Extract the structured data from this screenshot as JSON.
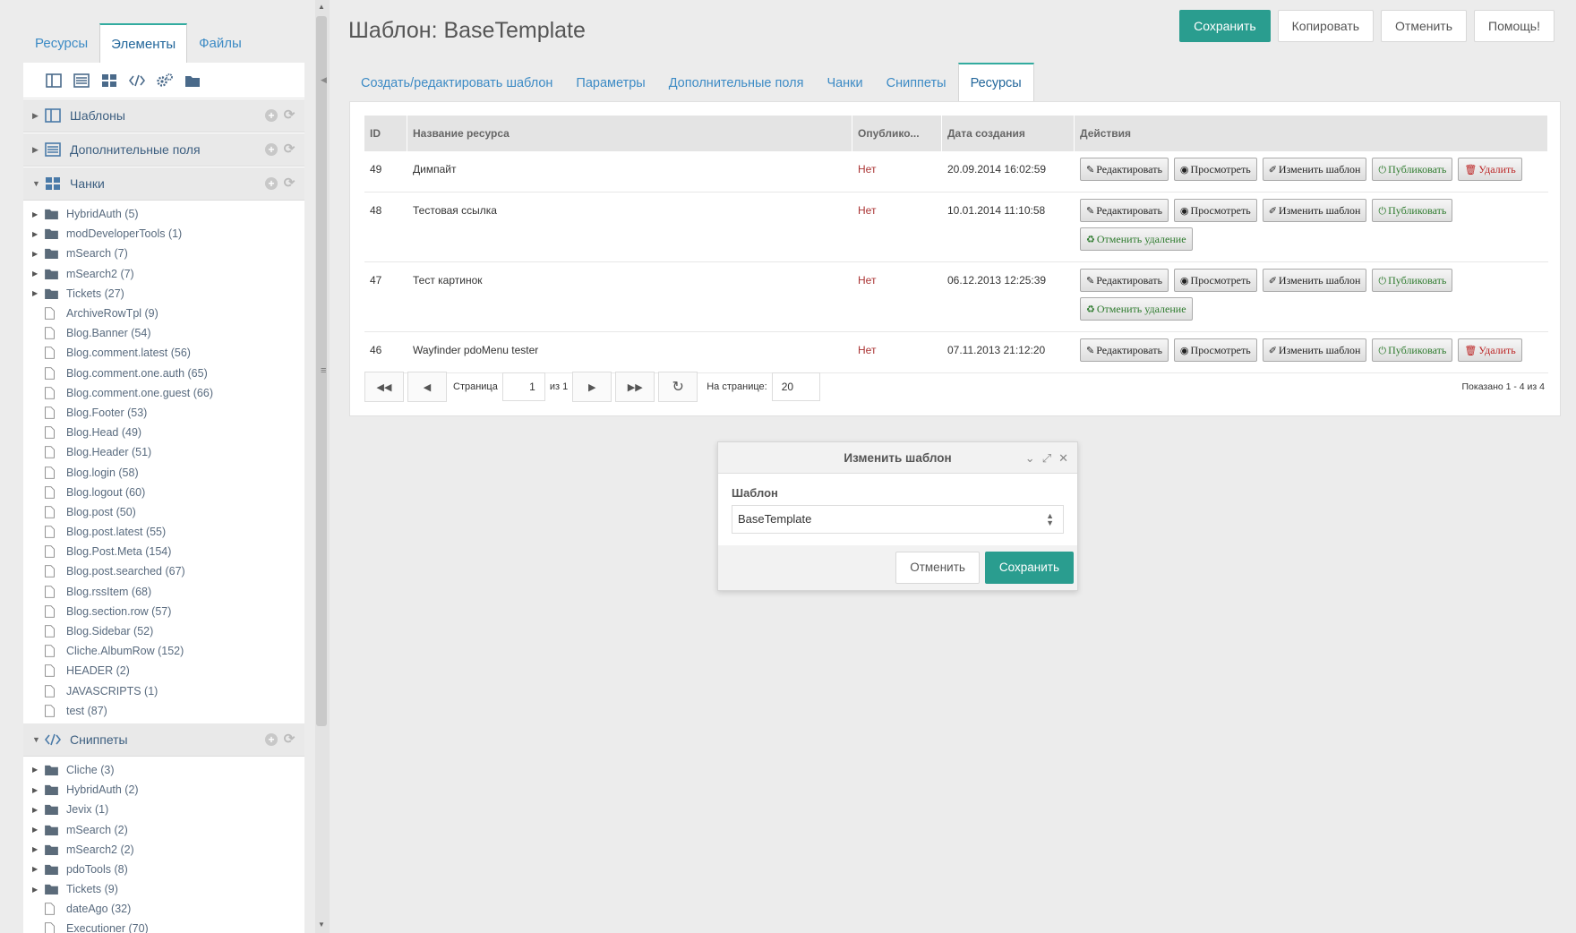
{
  "left": {
    "tabs": [
      {
        "label": "Ресурсы"
      },
      {
        "label": "Элементы"
      },
      {
        "label": "Файлы"
      }
    ],
    "toolbar_icons": [
      "template-icon",
      "tv-icon",
      "chunk-icon",
      "code-icon",
      "gears-icon",
      "folder-icon"
    ],
    "sections": {
      "templates": {
        "title": "Шаблоны"
      },
      "tvs": {
        "title": "Дополнительные поля"
      },
      "chunks": {
        "title": "Чанки",
        "items": [
          {
            "label": "HybridAuth (5)",
            "type": "folder"
          },
          {
            "label": "modDeveloperTools (1)",
            "type": "folder"
          },
          {
            "label": "mSearch (7)",
            "type": "folder"
          },
          {
            "label": "mSearch2 (7)",
            "type": "folder"
          },
          {
            "label": "Tickets (27)",
            "type": "folder"
          },
          {
            "label": "ArchiveRowTpl (9)",
            "type": "file"
          },
          {
            "label": "Blog.Banner (54)",
            "type": "file"
          },
          {
            "label": "Blog.comment.latest (56)",
            "type": "file"
          },
          {
            "label": "Blog.comment.one.auth (65)",
            "type": "file"
          },
          {
            "label": "Blog.comment.one.guest (66)",
            "type": "file"
          },
          {
            "label": "Blog.Footer (53)",
            "type": "file"
          },
          {
            "label": "Blog.Head (49)",
            "type": "file"
          },
          {
            "label": "Blog.Header (51)",
            "type": "file"
          },
          {
            "label": "Blog.login (58)",
            "type": "file"
          },
          {
            "label": "Blog.logout (60)",
            "type": "file"
          },
          {
            "label": "Blog.post (50)",
            "type": "file"
          },
          {
            "label": "Blog.post.latest (55)",
            "type": "file"
          },
          {
            "label": "Blog.Post.Meta (154)",
            "type": "file"
          },
          {
            "label": "Blog.post.searched (67)",
            "type": "file"
          },
          {
            "label": "Blog.rssItem (68)",
            "type": "file"
          },
          {
            "label": "Blog.section.row (57)",
            "type": "file"
          },
          {
            "label": "Blog.Sidebar (52)",
            "type": "file"
          },
          {
            "label": "Cliche.AlbumRow (152)",
            "type": "file"
          },
          {
            "label": "HEADER (2)",
            "type": "file"
          },
          {
            "label": "JAVASCRIPTS (1)",
            "type": "file"
          },
          {
            "label": "test (87)",
            "type": "file"
          }
        ]
      },
      "snippets": {
        "title": "Сниппеты",
        "items": [
          {
            "label": "Cliche (3)",
            "type": "folder"
          },
          {
            "label": "HybridAuth (2)",
            "type": "folder"
          },
          {
            "label": "Jevix (1)",
            "type": "folder"
          },
          {
            "label": "mSearch (2)",
            "type": "folder"
          },
          {
            "label": "mSearch2 (2)",
            "type": "folder"
          },
          {
            "label": "pdoTools (8)",
            "type": "folder"
          },
          {
            "label": "Tickets (9)",
            "type": "folder"
          },
          {
            "label": "dateAgo (32)",
            "type": "file"
          },
          {
            "label": "Executioner (70)",
            "type": "file"
          }
        ]
      }
    }
  },
  "header": {
    "title": "Шаблон: BaseTemplate",
    "buttons": {
      "save": "Сохранить",
      "copy": "Копировать",
      "cancel": "Отменить",
      "help": "Помощь!"
    }
  },
  "main_tabs": [
    {
      "label": "Создать/редактировать шаблон"
    },
    {
      "label": "Параметры"
    },
    {
      "label": "Дополнительные поля"
    },
    {
      "label": "Чанки"
    },
    {
      "label": "Сниппеты"
    },
    {
      "label": "Ресурсы"
    }
  ],
  "grid": {
    "columns": {
      "id": "ID",
      "name": "Название ресурса",
      "published": "Опублико...",
      "created": "Дата создания",
      "actions": "Действия"
    },
    "action_labels": {
      "edit": "Редактировать",
      "view": "Просмотреть",
      "change_template": "Изменить шаблон",
      "publish": "Публиковать",
      "delete": "Удалить",
      "undelete": "Отменить удаление"
    },
    "rows": [
      {
        "id": "49",
        "name": "Димпайт",
        "published": "Нет",
        "created": "20.09.2014 16:02:59",
        "deleted": false
      },
      {
        "id": "48",
        "name": "Тестовая ссылка",
        "published": "Нет",
        "created": "10.01.2014 11:10:58",
        "deleted": true
      },
      {
        "id": "47",
        "name": "Тест картинок",
        "published": "Нет",
        "created": "06.12.2013 12:25:39",
        "deleted": true
      },
      {
        "id": "46",
        "name": "Wayfinder pdoMenu tester",
        "published": "Нет",
        "created": "07.11.2013 21:12:20",
        "deleted": false
      }
    ]
  },
  "pager": {
    "page_label": "Страница",
    "page": "1",
    "of_label": "из 1",
    "per_page_label": "На странице:",
    "per_page": "20",
    "shown": "Показано 1 - 4 из 4"
  },
  "dialog": {
    "title": "Изменить шаблон",
    "field_label": "Шаблон",
    "select_value": "BaseTemplate",
    "cancel": "Отменить",
    "save": "Сохранить"
  },
  "colors": {
    "accent": "#2a9d8f",
    "link": "#3d8bc5",
    "no_published": "#aa3333"
  }
}
